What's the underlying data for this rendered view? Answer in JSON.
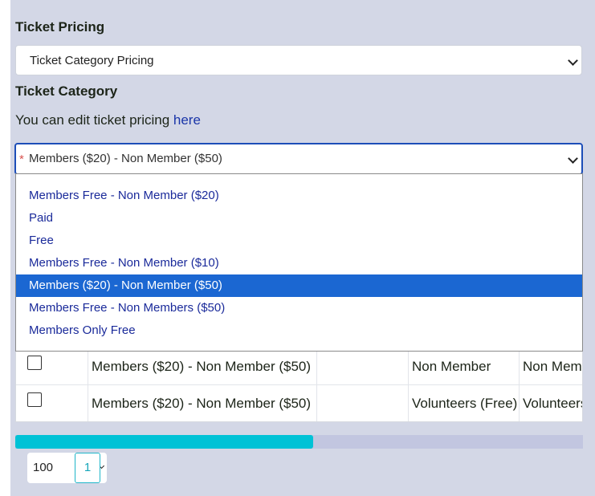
{
  "ticket_pricing": {
    "label": "Ticket Pricing",
    "selected": "Ticket Category Pricing"
  },
  "ticket_category": {
    "label": "Ticket Category",
    "hint_text": "You can edit ticket pricing ",
    "hint_link": "here",
    "required_marker": "*",
    "selected": "Members ($20) - Non Member ($50)",
    "options": [
      "",
      "Members Free - Non Member ($20)",
      "Paid",
      "Free",
      "Members Free - Non Member ($10)",
      "Members ($20) - Non Member ($50)",
      "Members Free - Non Members ($50)",
      "Members Only Free"
    ],
    "selected_index": 5
  },
  "table": {
    "rows": [
      {
        "category": "Members ($20) - Non Member ($50)",
        "col3": "",
        "type": "Non Member",
        "name": "Non Member"
      },
      {
        "category": "Members ($20) - Non Member ($50)",
        "col3": "",
        "type": "Volunteers (Free)",
        "name": "Volunteers"
      }
    ]
  },
  "progress": {
    "fraction": 0.525
  },
  "pager": {
    "page_size": "100",
    "current_page": "1"
  },
  "colors": {
    "panel_bg": "#d3d7e6",
    "accent_blue": "#1b67d2",
    "progress_fill": "#00c2d6",
    "link": "#1a35a8"
  }
}
